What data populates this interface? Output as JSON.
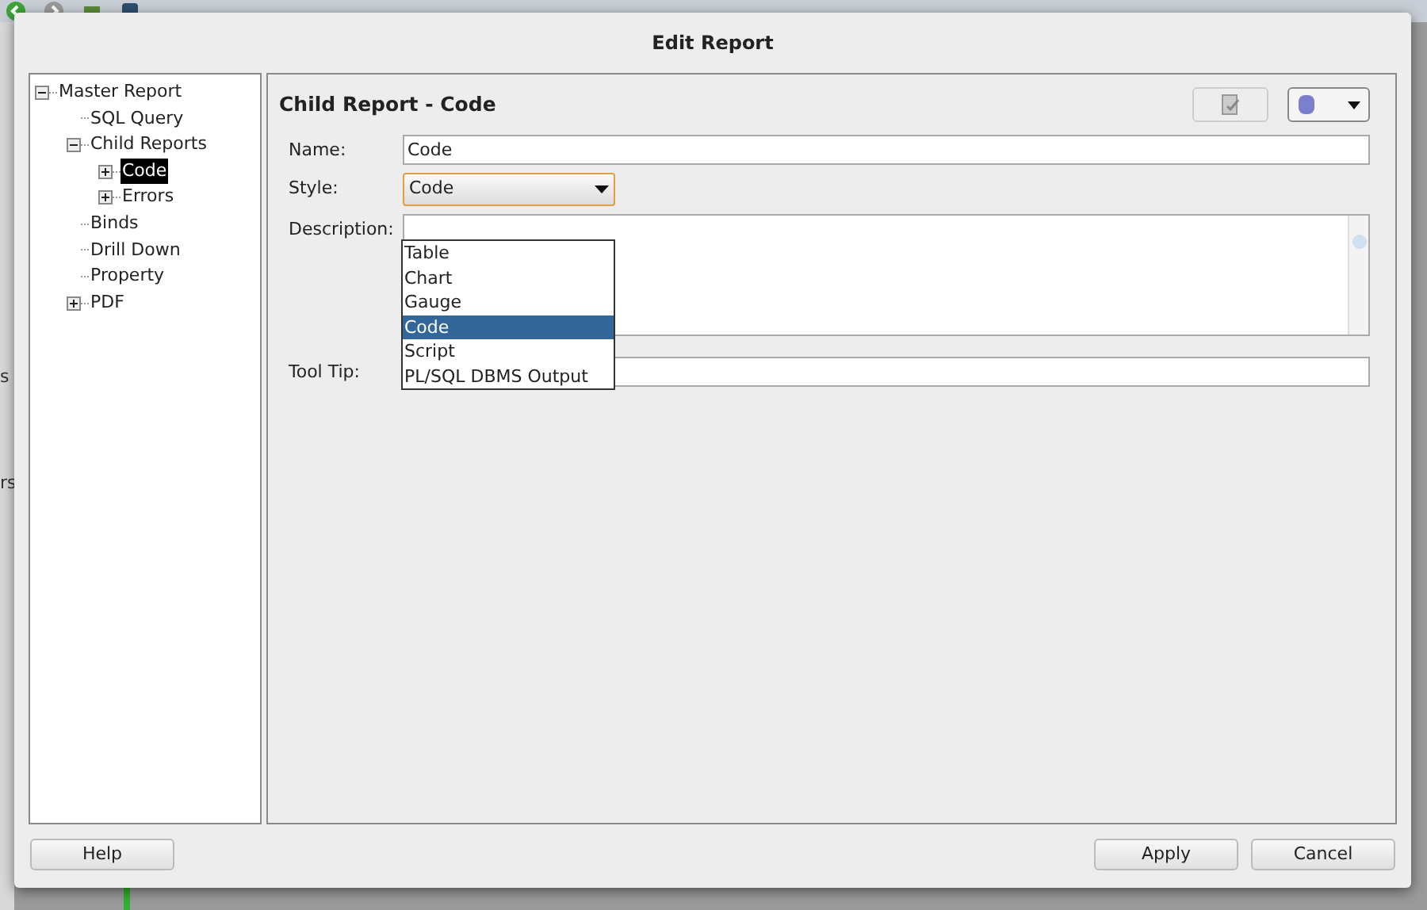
{
  "background_fragments": [
    "s",
    "rs"
  ],
  "window": {
    "title": "Edit Report"
  },
  "tree": [
    {
      "label": "Master Report",
      "expanded": true,
      "selected": false,
      "children": [
        {
          "label": "SQL Query",
          "selected": false
        },
        {
          "label": "Child Reports",
          "expanded": true,
          "selected": false,
          "children": [
            {
              "label": "Code",
              "expanded": false,
              "selected": true
            },
            {
              "label": "Errors",
              "expanded": false,
              "selected": false
            }
          ]
        },
        {
          "label": "Binds",
          "selected": false
        },
        {
          "label": "Drill Down",
          "selected": false
        },
        {
          "label": "Property",
          "selected": false
        },
        {
          "label": "PDF",
          "expanded": false,
          "selected": false
        }
      ]
    }
  ],
  "panel": {
    "title": "Child Report - Code",
    "fields": [
      {
        "label": "Name:",
        "value": "Code"
      },
      {
        "label": "Style:",
        "value": "Code"
      },
      {
        "label": "Description:"
      },
      {
        "label": "Tool Tip:"
      }
    ],
    "style_options": [
      {
        "label": "Table",
        "selected": false
      },
      {
        "label": "Chart",
        "selected": false
      },
      {
        "label": "Gauge",
        "selected": false
      },
      {
        "label": "Code",
        "selected": true
      },
      {
        "label": "Script",
        "selected": false
      },
      {
        "label": "PL/SQL DBMS Output",
        "selected": false
      }
    ]
  },
  "buttons": [
    {
      "label": "Help"
    },
    {
      "label": "Apply"
    },
    {
      "label": "Cancel"
    }
  ]
}
